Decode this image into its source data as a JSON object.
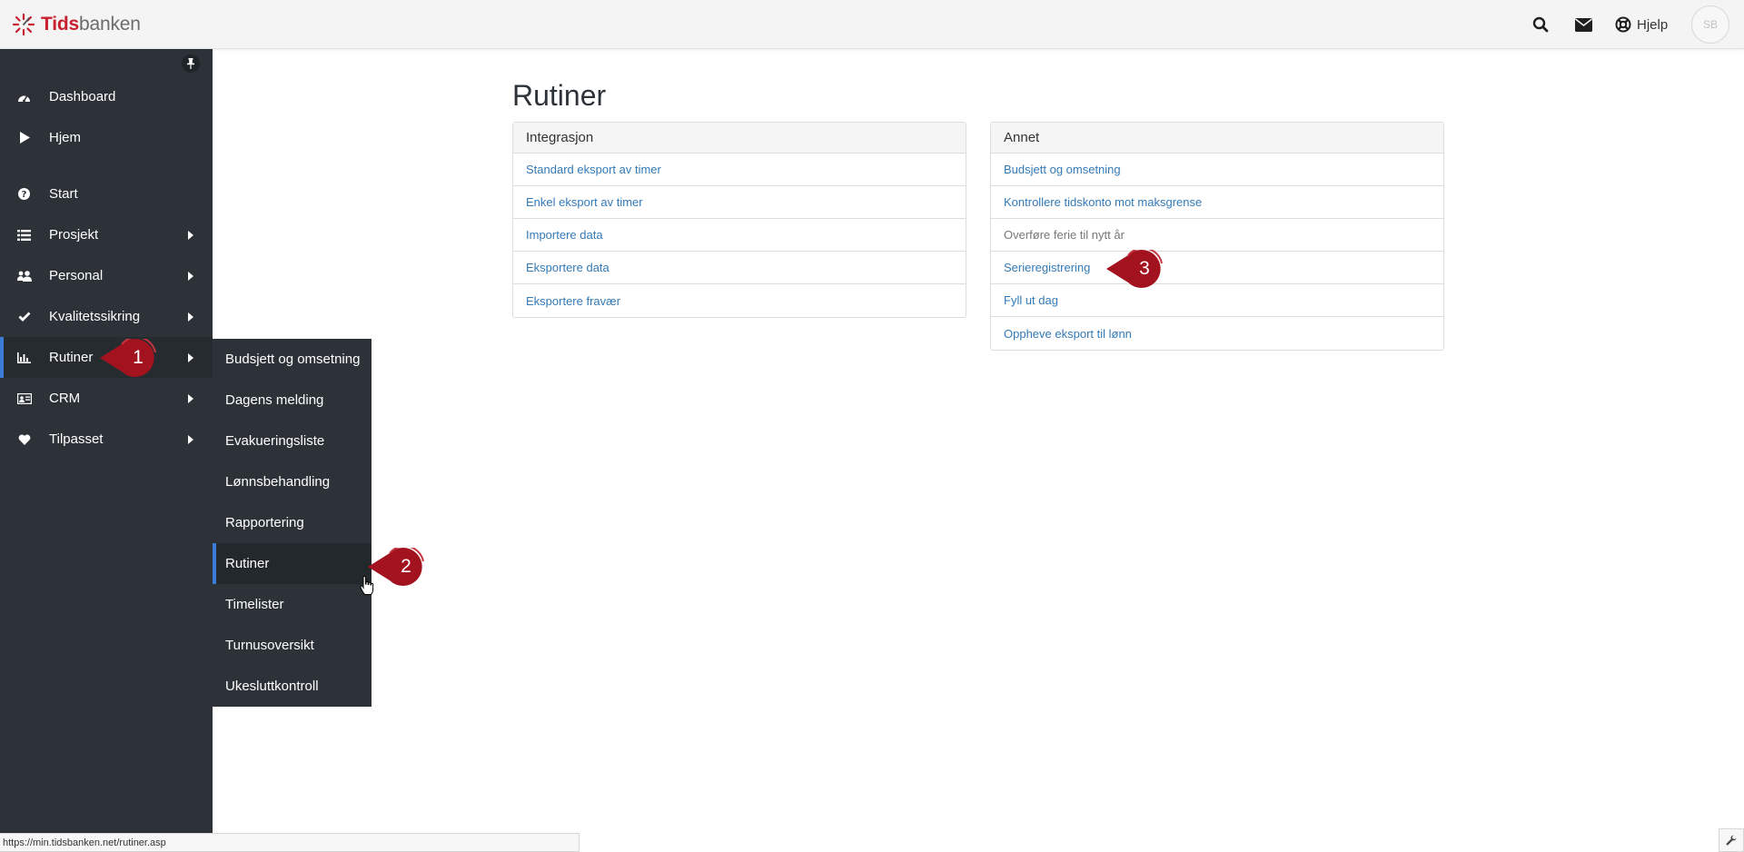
{
  "app": {
    "logo_part1": "Tids",
    "logo_part2": "banken"
  },
  "topbar": {
    "search_icon": "search-icon",
    "mail_icon": "envelope-icon",
    "help_label": "Hjelp",
    "avatar_initials": "SB"
  },
  "sidebar": {
    "items": [
      {
        "label": "Dashboard",
        "icon": "dashboard-icon"
      },
      {
        "label": "Hjem",
        "icon": "play-icon"
      },
      {
        "label": "Start",
        "icon": "question-circle-icon"
      },
      {
        "label": "Prosjekt",
        "icon": "list-icon"
      },
      {
        "label": "Personal",
        "icon": "users-icon"
      },
      {
        "label": "Kvalitetssikring",
        "icon": "check-icon"
      },
      {
        "label": "Rutiner",
        "icon": "bar-chart-icon"
      },
      {
        "label": "CRM",
        "icon": "id-card-icon"
      },
      {
        "label": "Tilpasset",
        "icon": "heart-icon"
      }
    ]
  },
  "submenu": {
    "items": [
      "Budsjett og omsetning",
      "Dagens melding",
      "Evakueringsliste",
      "Lønnsbehandling",
      "Rapportering",
      "Rutiner",
      "Timelister",
      "Turnusoversikt",
      "Ukesluttkontroll"
    ]
  },
  "main": {
    "title": "Rutiner",
    "panels": [
      {
        "header": "Integrasjon",
        "rows": [
          "Standard eksport av timer",
          "Enkel eksport av timer",
          "Importere data",
          "Eksportere data",
          "Eksportere fravær"
        ]
      },
      {
        "header": "Annet",
        "rows": [
          "Budsjett og omsetning",
          "Kontrollere tidskonto mot maksgrense",
          "Overføre ferie til nytt år",
          "Serieregistrering",
          "Fyll ut dag",
          "Oppheve eksport til lønn"
        ]
      }
    ]
  },
  "callouts": [
    "1",
    "2",
    "3"
  ],
  "callout_color": "#a3121f",
  "statusbar": {
    "url": "https://min.tidsbanken.net/rutiner.asp"
  },
  "colors": {
    "sidebar": "#2c3238",
    "accent": "#3d7bd8",
    "link": "#337ab7",
    "brand": "#c8202f"
  }
}
